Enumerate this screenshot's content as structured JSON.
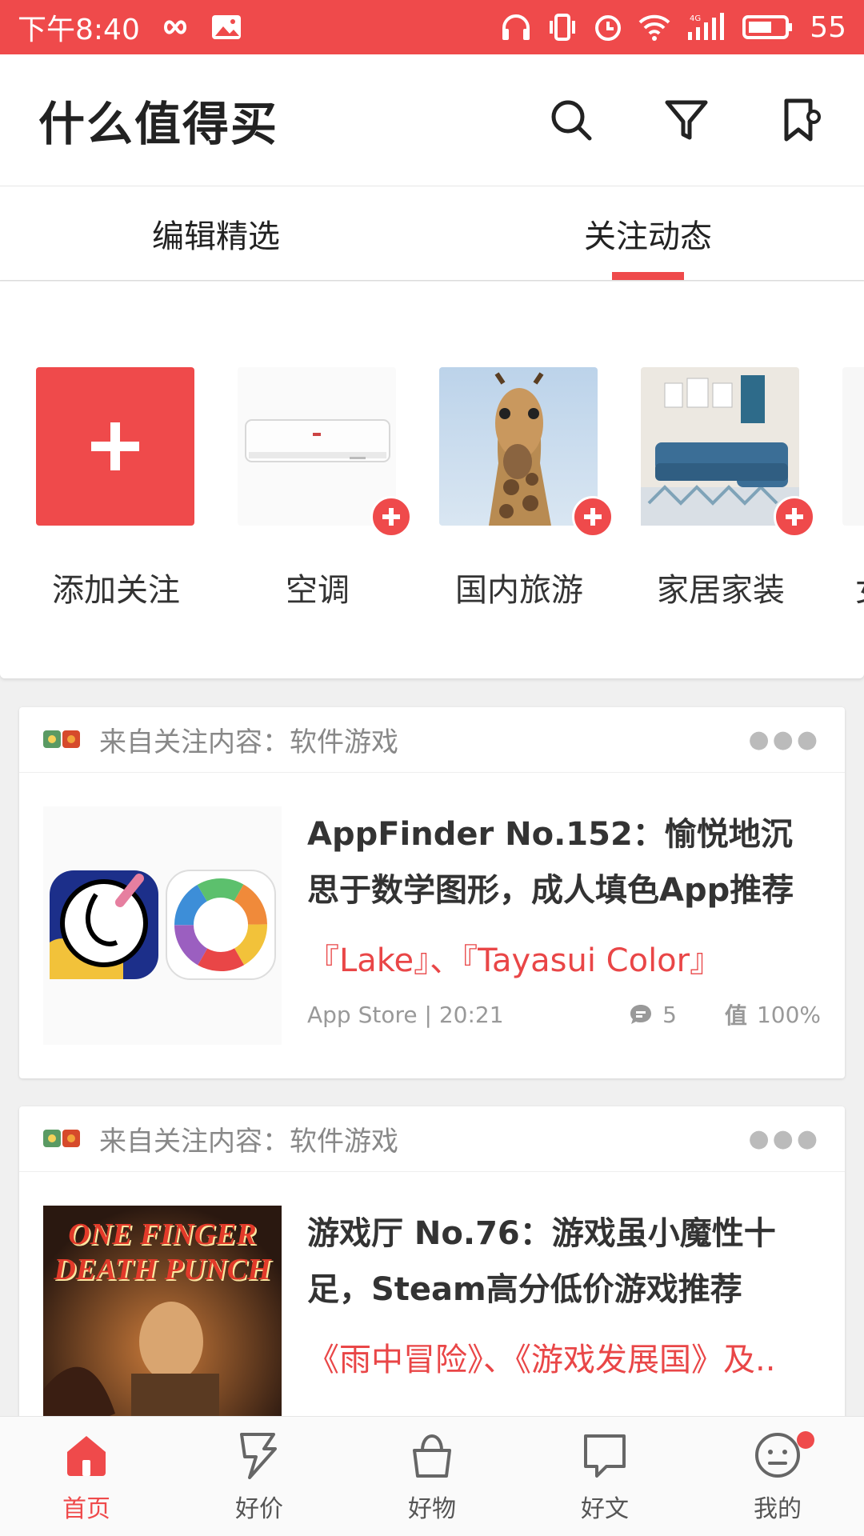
{
  "status_bar": {
    "time": "下午8:40",
    "battery": "55",
    "network": "4G"
  },
  "app_bar": {
    "title": "什么值得买",
    "icons": [
      "search-icon",
      "filter-icon",
      "bookmark-icon"
    ]
  },
  "tabs": [
    {
      "label": "编辑精选",
      "active": false
    },
    {
      "label": "关注动态",
      "active": true
    }
  ],
  "follow_topics": [
    {
      "label": "添加关注",
      "icon": "plus-icon"
    },
    {
      "label": "空调",
      "icon": "air-conditioner-image"
    },
    {
      "label": "国内旅游",
      "icon": "giraffe-image"
    },
    {
      "label": "家居家装",
      "icon": "sofa-image"
    },
    {
      "label": "女",
      "icon": "partial-item"
    }
  ],
  "cards": [
    {
      "source_label": "来自关注内容：软件游戏",
      "title": "AppFinder No.152：愉悦地沉思于数学图形，成人填色App推荐",
      "subtitle": "『Lake』、『Tayasui Color』",
      "meta_source": "App Store | 20:21",
      "comments": "5",
      "worth_label": "值",
      "worth": "100%"
    },
    {
      "source_label": "来自关注内容：软件游戏",
      "title": "游戏厅 No.76：游戏虽小魔性十足，Steam高分低价游戏推荐",
      "subtitle": "《雨中冒险》、《游戏发展国》及..",
      "image_text": "ONE FINGER DEATH PUNCH"
    }
  ],
  "bottom_nav": [
    {
      "label": "首页",
      "active": true,
      "icon": "home-icon"
    },
    {
      "label": "好价",
      "active": false,
      "icon": "lightning-tag-icon"
    },
    {
      "label": "好物",
      "active": false,
      "icon": "shopping-bag-icon"
    },
    {
      "label": "好文",
      "active": false,
      "icon": "chat-bubble-icon"
    },
    {
      "label": "我的",
      "active": false,
      "icon": "profile-face-icon"
    }
  ],
  "colors": {
    "accent": "#ef4a4b",
    "text_red": "#e94647"
  }
}
